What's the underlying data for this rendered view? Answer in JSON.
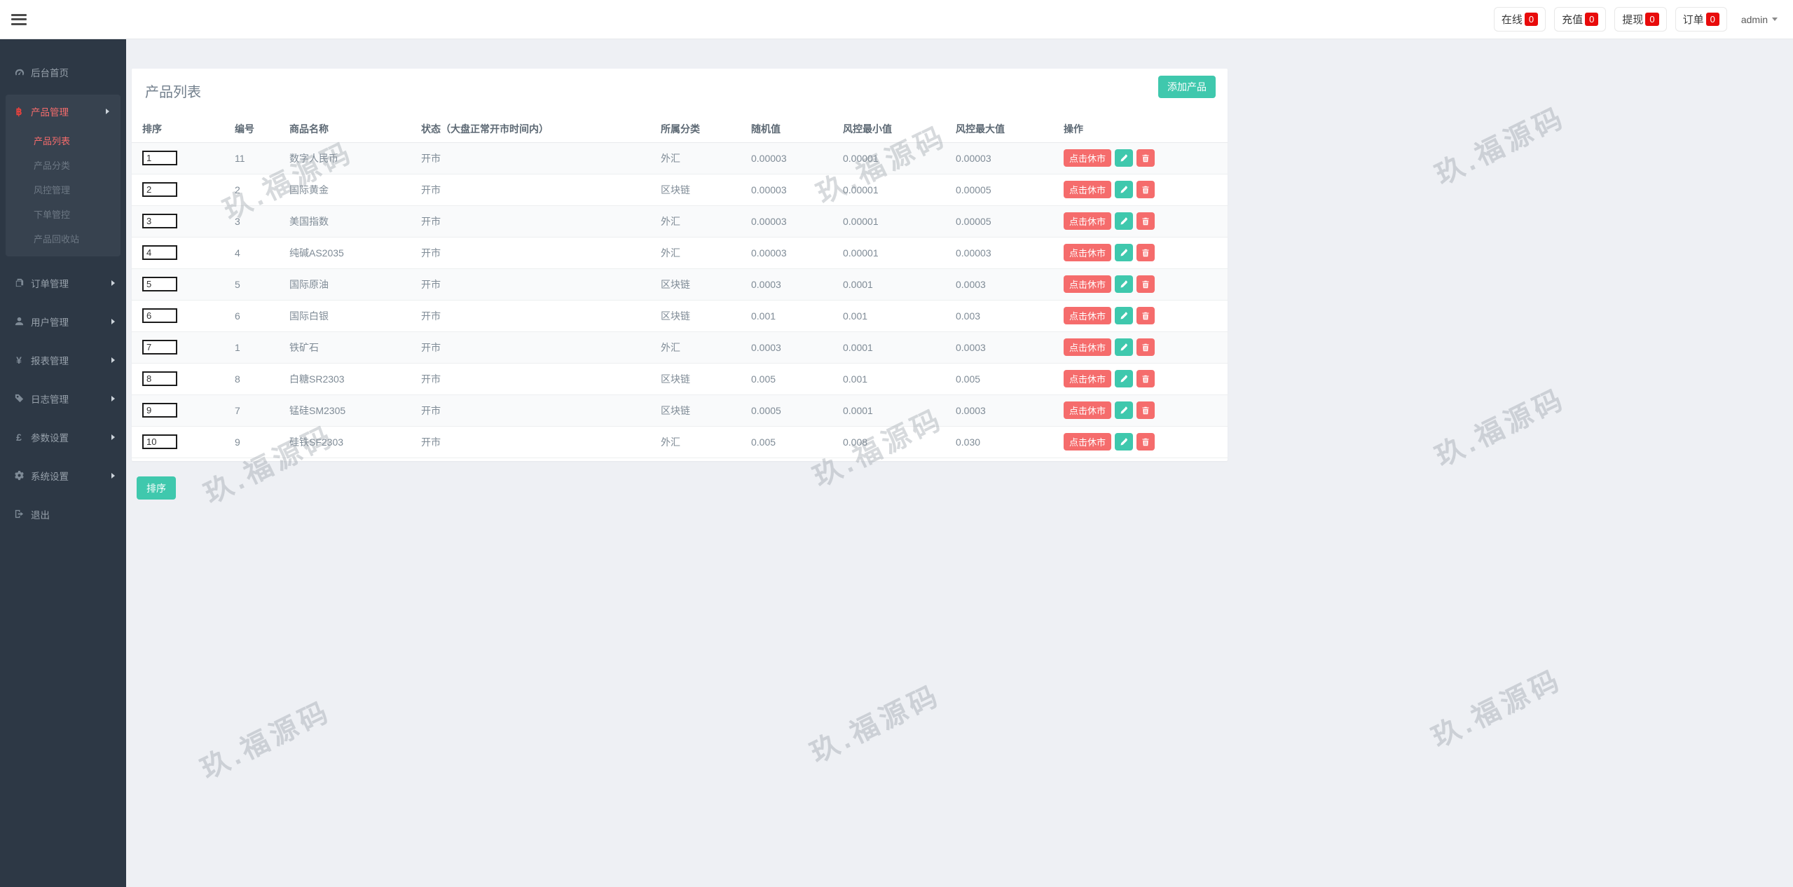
{
  "navbar": {
    "stats": [
      {
        "label": "在线",
        "count": "0"
      },
      {
        "label": "充值",
        "count": "0"
      },
      {
        "label": "提现",
        "count": "0"
      },
      {
        "label": "订单",
        "count": "0"
      }
    ],
    "user": "admin"
  },
  "sidebar": {
    "items": [
      {
        "label": "后台首页"
      },
      {
        "label": "产品管理",
        "children": [
          "产品列表",
          "产品分类",
          "风控管理",
          "下单管控",
          "产品回收站"
        ]
      },
      {
        "label": "订单管理"
      },
      {
        "label": "用户管理"
      },
      {
        "label": "报表管理"
      },
      {
        "label": "日志管理"
      },
      {
        "label": "参数设置"
      },
      {
        "label": "系统设置"
      },
      {
        "label": "退出"
      }
    ]
  },
  "page": {
    "card_title": "产品列表",
    "add_button": "添加产品",
    "sort_button": "排序",
    "table": {
      "headers": [
        "排序",
        "编号",
        "商品名称",
        "状态（大盘正常开市时间内）",
        "所属分类",
        "随机值",
        "风控最小值",
        "风控最大值",
        "操作"
      ],
      "action_labels": {
        "close_market": "点击休市"
      },
      "rows": [
        {
          "sort": "1",
          "id": "11",
          "name": "数字人民币",
          "status": "开市",
          "category": "外汇",
          "random": "0.00003",
          "risk_min": "0.00001",
          "risk_max": "0.00003"
        },
        {
          "sort": "2",
          "id": "2",
          "name": "国际黄金",
          "status": "开市",
          "category": "区块链",
          "random": "0.00003",
          "risk_min": "0.00001",
          "risk_max": "0.00005"
        },
        {
          "sort": "3",
          "id": "3",
          "name": "美国指数",
          "status": "开市",
          "category": "外汇",
          "random": "0.00003",
          "risk_min": "0.00001",
          "risk_max": "0.00005"
        },
        {
          "sort": "4",
          "id": "4",
          "name": "纯碱AS2035",
          "status": "开市",
          "category": "外汇",
          "random": "0.00003",
          "risk_min": "0.00001",
          "risk_max": "0.00003"
        },
        {
          "sort": "5",
          "id": "5",
          "name": "国际原油",
          "status": "开市",
          "category": "区块链",
          "random": "0.0003",
          "risk_min": "0.0001",
          "risk_max": "0.0003"
        },
        {
          "sort": "6",
          "id": "6",
          "name": "国际白银",
          "status": "开市",
          "category": "区块链",
          "random": "0.001",
          "risk_min": "0.001",
          "risk_max": "0.003"
        },
        {
          "sort": "7",
          "id": "1",
          "name": "铁矿石",
          "status": "开市",
          "category": "外汇",
          "random": "0.0003",
          "risk_min": "0.0001",
          "risk_max": "0.0003"
        },
        {
          "sort": "8",
          "id": "8",
          "name": "白糖SR2303",
          "status": "开市",
          "category": "区块链",
          "random": "0.005",
          "risk_min": "0.001",
          "risk_max": "0.005"
        },
        {
          "sort": "9",
          "id": "7",
          "name": "锰硅SM2305",
          "status": "开市",
          "category": "区块链",
          "random": "0.0005",
          "risk_min": "0.0001",
          "risk_max": "0.0003"
        },
        {
          "sort": "10",
          "id": "9",
          "name": "硅铁SF2303",
          "status": "开市",
          "category": "外汇",
          "random": "0.005",
          "risk_min": "0.008",
          "risk_max": "0.030"
        }
      ]
    }
  },
  "watermark": {
    "text": "玖.福源码"
  },
  "colors": {
    "accent_teal": "#3fc8ad",
    "accent_red": "#f56c6c",
    "badge_red": "#e80b0b",
    "sidebar_bg": "#2d3845"
  }
}
